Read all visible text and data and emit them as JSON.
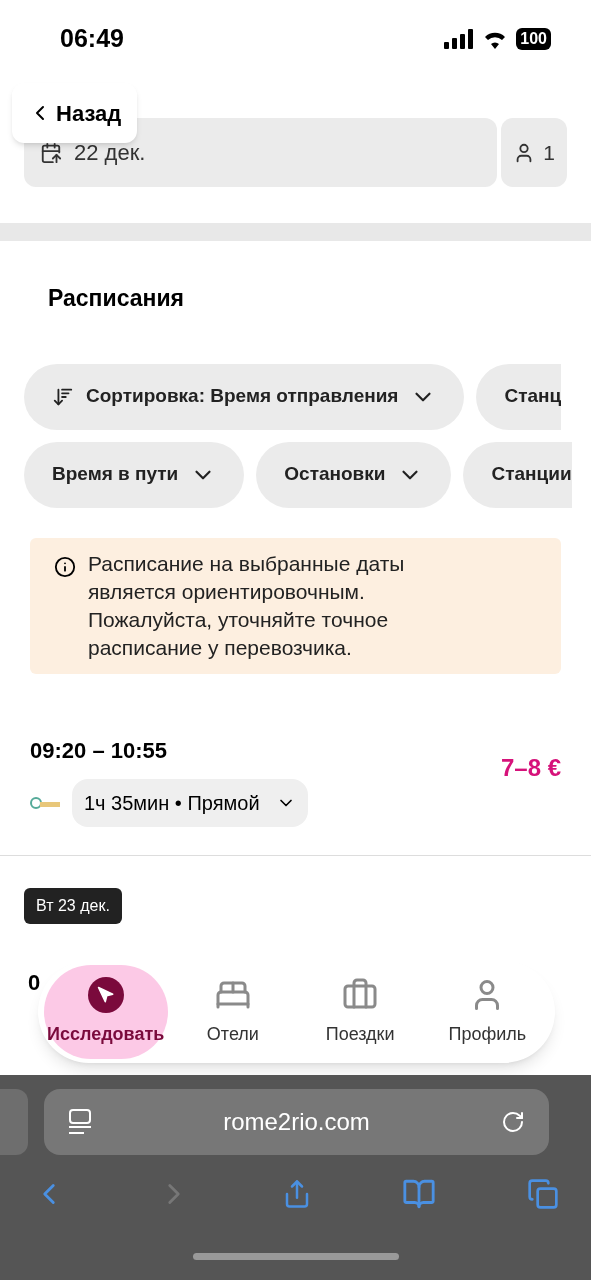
{
  "status_bar": {
    "time": "06:49",
    "battery": "100"
  },
  "header": {
    "back_label": "Назад",
    "date": "22 дек.",
    "passengers": "1"
  },
  "section_title": "Расписания",
  "filter_rows": [
    [
      {
        "label": "Сортировка: Время отправления",
        "kind": "sort"
      },
      {
        "label": "Станц",
        "kind": "cut"
      }
    ],
    [
      {
        "label": "Время в пути",
        "kind": "dropdown"
      },
      {
        "label": "Остановки",
        "kind": "dropdown"
      },
      {
        "label": "Станции",
        "kind": "cut"
      }
    ]
  ],
  "notice": "Расписание на выбранные даты является ориентировочным. Пожалуйста, уточняйте точное расписание у перевозчика.",
  "trip": {
    "times": "09:20 – 10:55",
    "details": "1ч 35мин • Прямой",
    "price": "7–8 €"
  },
  "day_badge": "Вт 23 дек.",
  "partial_trip": {
    "times": "0"
  },
  "bottom_nav": [
    {
      "label": "Исследовать",
      "kind": "explore",
      "selected": true
    },
    {
      "label": "Отели",
      "kind": "bed",
      "selected": false
    },
    {
      "label": "Поездки",
      "kind": "trips",
      "selected": false
    },
    {
      "label": "Профиль",
      "kind": "profile",
      "selected": false
    }
  ],
  "browser": {
    "url": "rome2rio.com"
  }
}
